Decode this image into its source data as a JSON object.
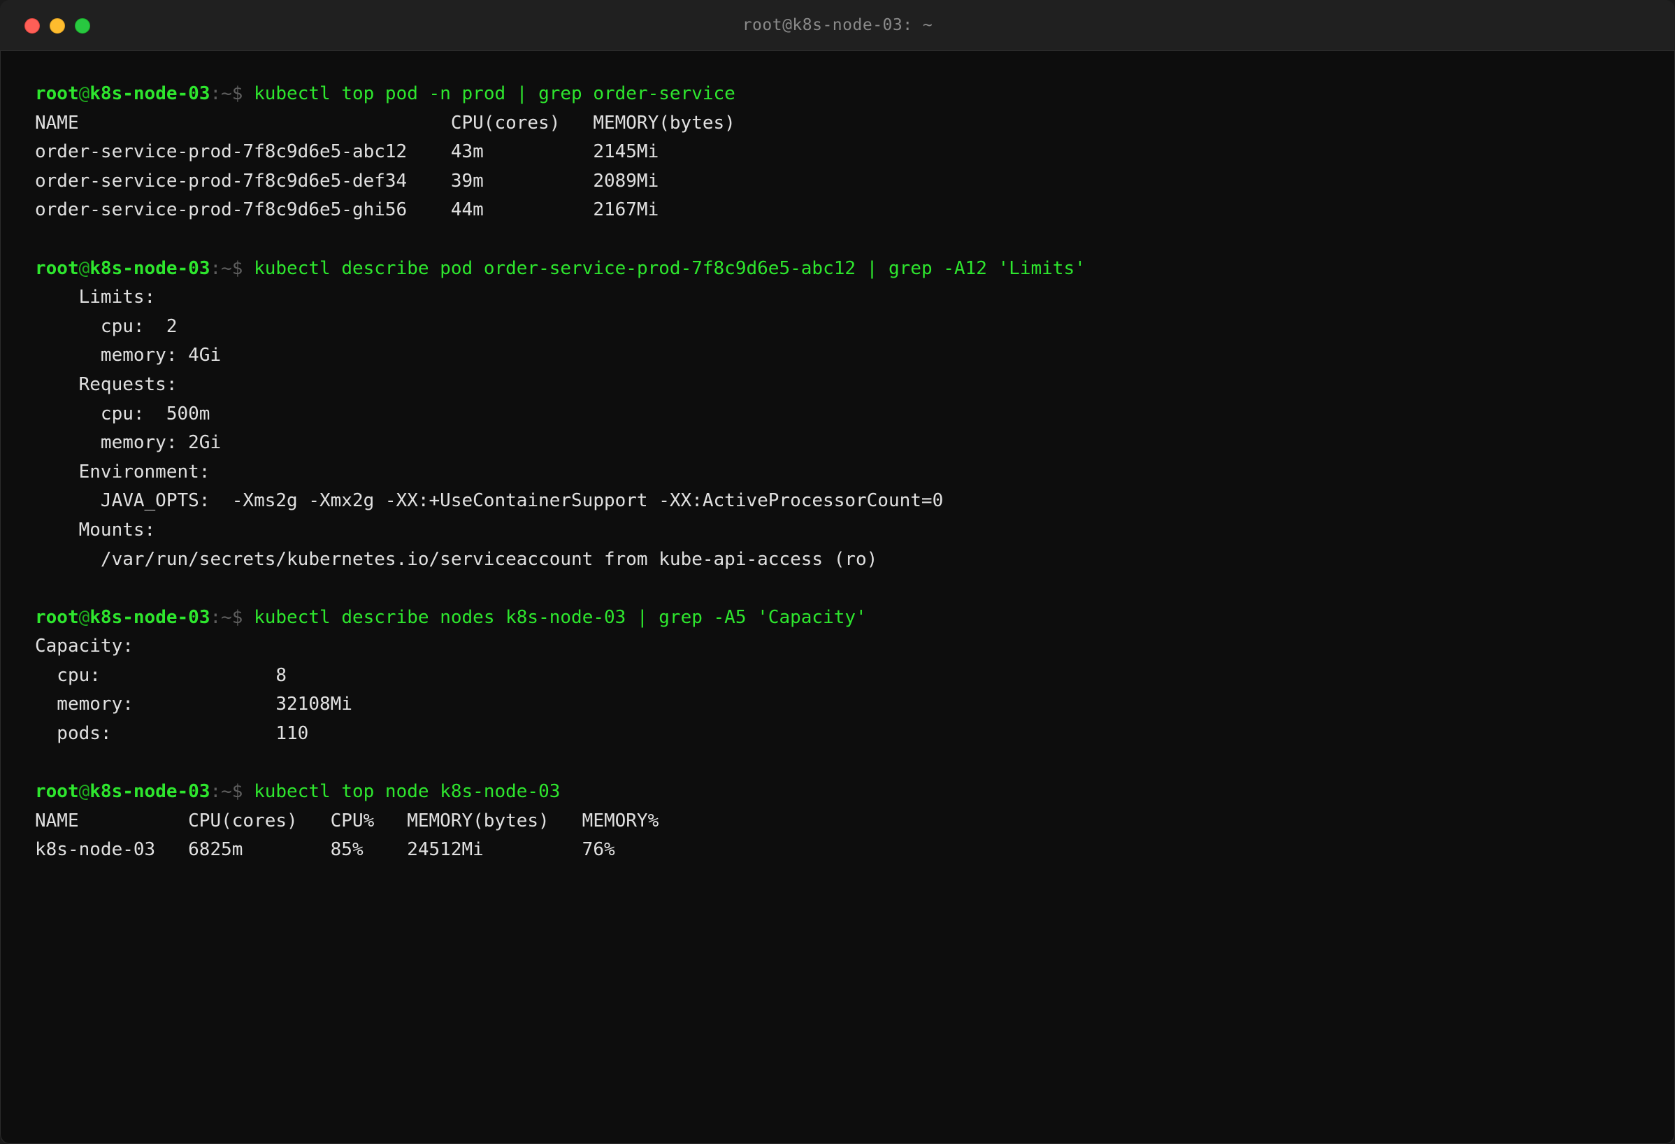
{
  "window": {
    "title": "root@k8s-node-03: ~"
  },
  "prompt": {
    "user": "root",
    "at": "@",
    "host": "k8s-node-03",
    "sep": ":~$ "
  },
  "colors": {
    "prompt_green": "#2ee62e",
    "background": "#0d0d0d",
    "output_text": "#e0e0e0"
  },
  "blocks": [
    {
      "command": "kubectl top pod -n prod | grep order-service",
      "output": [
        "NAME                                  CPU(cores)   MEMORY(bytes)",
        "order-service-prod-7f8c9d6e5-abc12    43m          2145Mi",
        "order-service-prod-7f8c9d6e5-def34    39m          2089Mi",
        "order-service-prod-7f8c9d6e5-ghi56    44m          2167Mi"
      ]
    },
    {
      "command": "kubectl describe pod order-service-prod-7f8c9d6e5-abc12 | grep -A12 'Limits'",
      "output": [
        "    Limits:",
        "      cpu:  2",
        "      memory: 4Gi",
        "    Requests:",
        "      cpu:  500m",
        "      memory: 2Gi",
        "    Environment:",
        "      JAVA_OPTS:  -Xms2g -Xmx2g -XX:+UseContainerSupport -XX:ActiveProcessorCount=0",
        "    Mounts:",
        "      /var/run/secrets/kubernetes.io/serviceaccount from kube-api-access (ro)"
      ]
    },
    {
      "command": "kubectl describe nodes k8s-node-03 | grep -A5 'Capacity'",
      "output": [
        "Capacity:",
        "  cpu:                8",
        "  memory:             32108Mi",
        "  pods:               110"
      ]
    },
    {
      "command": "kubectl top node k8s-node-03",
      "output": [
        "NAME          CPU(cores)   CPU%   MEMORY(bytes)   MEMORY%",
        "k8s-node-03   6825m        85%    24512Mi         76%"
      ]
    }
  ]
}
